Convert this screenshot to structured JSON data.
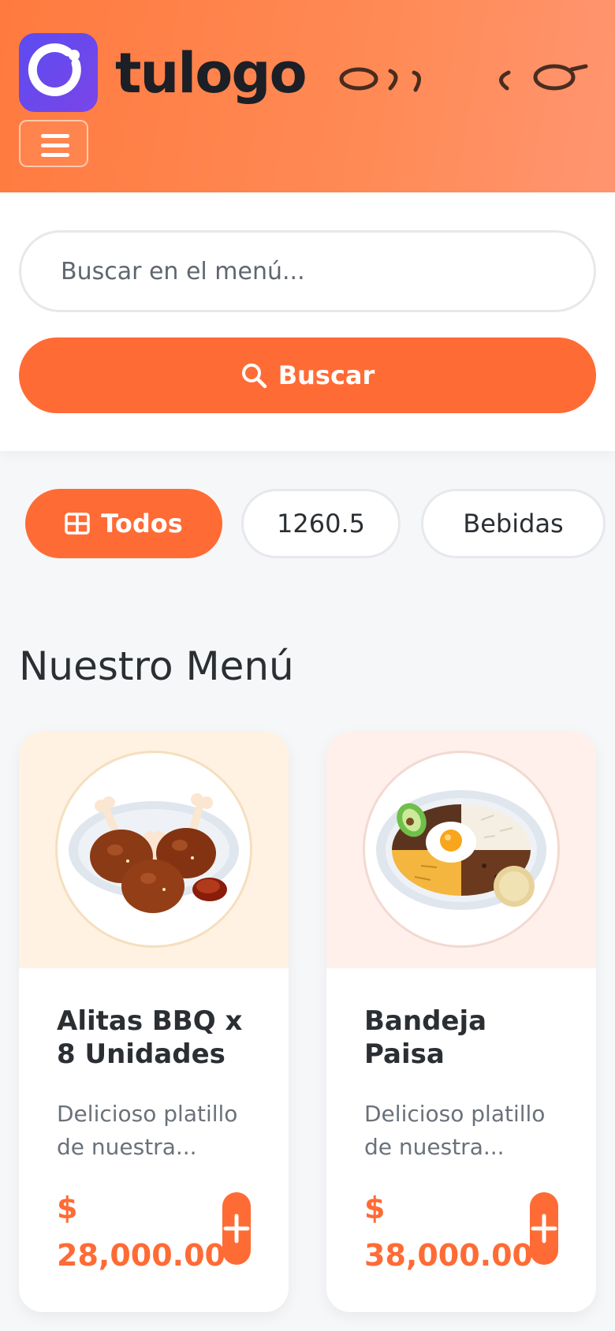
{
  "header": {
    "brand": "tulogo",
    "menu_icon": "hamburger-icon",
    "logo_icon": "circle-dot-logo-icon"
  },
  "search": {
    "placeholder": "Buscar en el menú...",
    "value": "",
    "button_label": "Buscar",
    "button_icon": "search-icon"
  },
  "categories": [
    {
      "label": "Todos",
      "icon": "grid-icon",
      "active": true
    },
    {
      "label": "1260.5",
      "active": false
    },
    {
      "label": "Bebidas",
      "active": false
    }
  ],
  "section_title": "Nuestro Menú",
  "products": [
    {
      "name": "Alitas BBQ x 8 Unidades",
      "description": "Delicioso platillo de nuestra...",
      "currency": "$",
      "price": "28,000.00",
      "image_icon": "bbq-wings-plate-icon",
      "add_icon": "plus-icon"
    },
    {
      "name": "Bandeja Paisa",
      "description": "Delicioso platillo de nuestra...",
      "currency": "$",
      "price": "38,000.00",
      "image_icon": "bandeja-paisa-plate-icon",
      "add_icon": "plus-icon"
    }
  ],
  "colors": {
    "accent": "#ff6b35",
    "header_gradient_start": "#ff7a3f",
    "logo_purple": "#6a48ec",
    "text_dark": "#2b2f33"
  }
}
